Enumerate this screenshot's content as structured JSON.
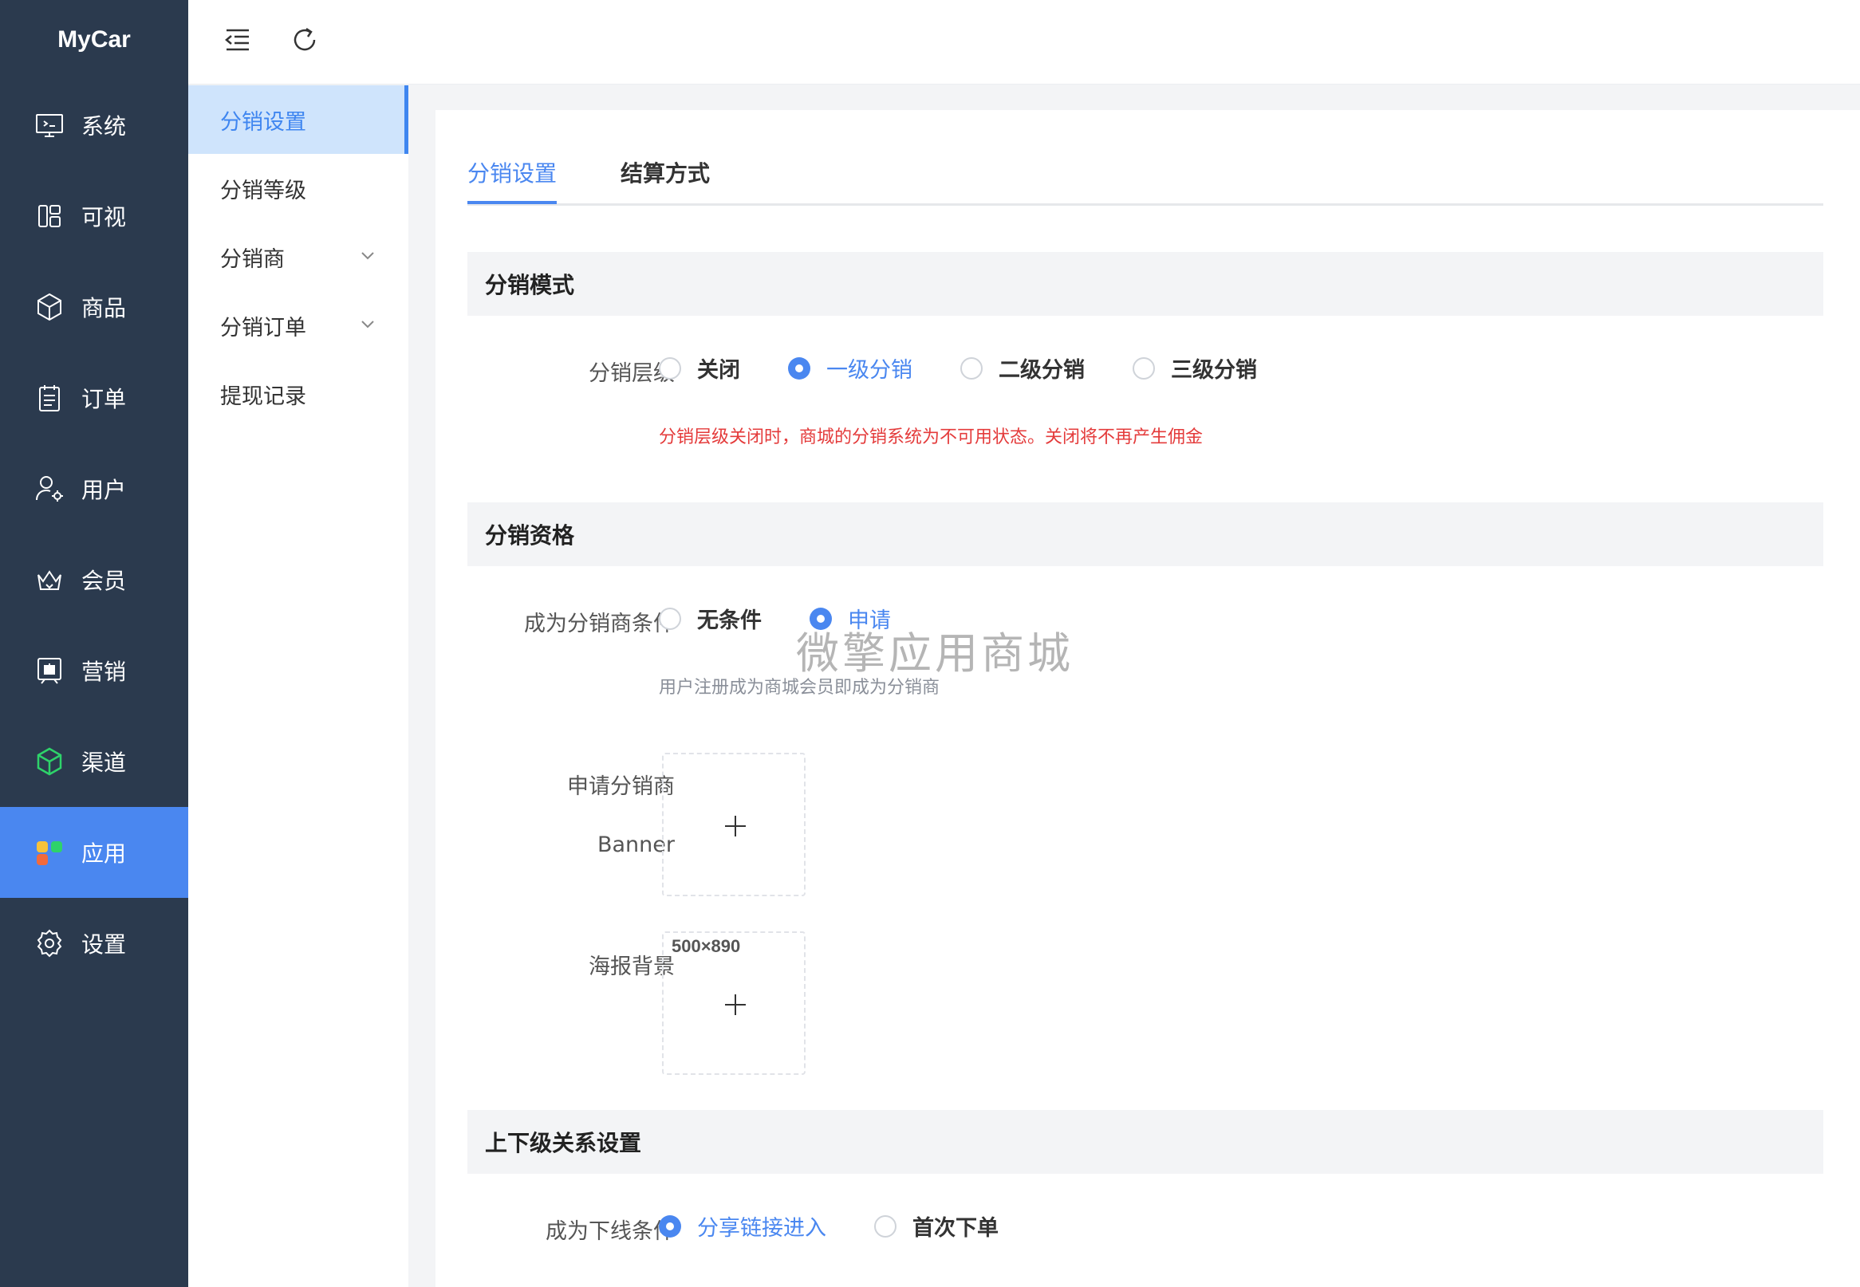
{
  "app": {
    "logo": "MyCar"
  },
  "sidebar": {
    "items": [
      {
        "label": "系统",
        "icon": "monitor-icon"
      },
      {
        "label": "可视",
        "icon": "layout-icon"
      },
      {
        "label": "商品",
        "icon": "box-icon"
      },
      {
        "label": "订单",
        "icon": "clipboard-icon"
      },
      {
        "label": "用户",
        "icon": "user-settings-icon"
      },
      {
        "label": "会员",
        "icon": "crown-icon"
      },
      {
        "label": "营销",
        "icon": "gift-board-icon"
      },
      {
        "label": "渠道",
        "icon": "cube-icon"
      },
      {
        "label": "应用",
        "icon": "apps-icon",
        "active": true
      },
      {
        "label": "设置",
        "icon": "gear-icon"
      }
    ]
  },
  "topbar": {
    "icons": [
      "collapse-menu-icon",
      "refresh-icon"
    ]
  },
  "submenu": {
    "items": [
      {
        "label": "分销设置",
        "active": true
      },
      {
        "label": "分销等级"
      },
      {
        "label": "分销商",
        "expandable": true
      },
      {
        "label": "分销订单",
        "expandable": true
      },
      {
        "label": "提现记录"
      }
    ]
  },
  "tabs": [
    {
      "label": "分销设置",
      "active": true
    },
    {
      "label": "结算方式"
    }
  ],
  "mode": {
    "title": "分销模式",
    "level_label": "分销层级",
    "options": [
      "关闭",
      "一级分销",
      "二级分销",
      "三级分销"
    ],
    "selected": "一级分销",
    "hint": "分销层级关闭时，商城的分销系统为不可用状态。关闭将不再产生佣金"
  },
  "qualification": {
    "title": "分销资格",
    "condition_label": "成为分销商条件",
    "options": [
      "无条件",
      "申请"
    ],
    "selected": "申请",
    "hint": "用户注册成为商城会员即成为分销商",
    "banner_label_1": "申请分销商",
    "banner_label_2": "Banner",
    "poster_label": "海报背景",
    "poster_size": "500×890"
  },
  "relation": {
    "title": "上下级关系设置",
    "condition_label": "成为下线条件",
    "options": [
      "分享链接进入",
      "首次下单"
    ],
    "selected": "分享链接进入"
  },
  "watermark": "微擎应用商城",
  "colors": {
    "sidebar": "#2b3a4e",
    "accent": "#4a87f0",
    "danger": "#e43b3b"
  }
}
